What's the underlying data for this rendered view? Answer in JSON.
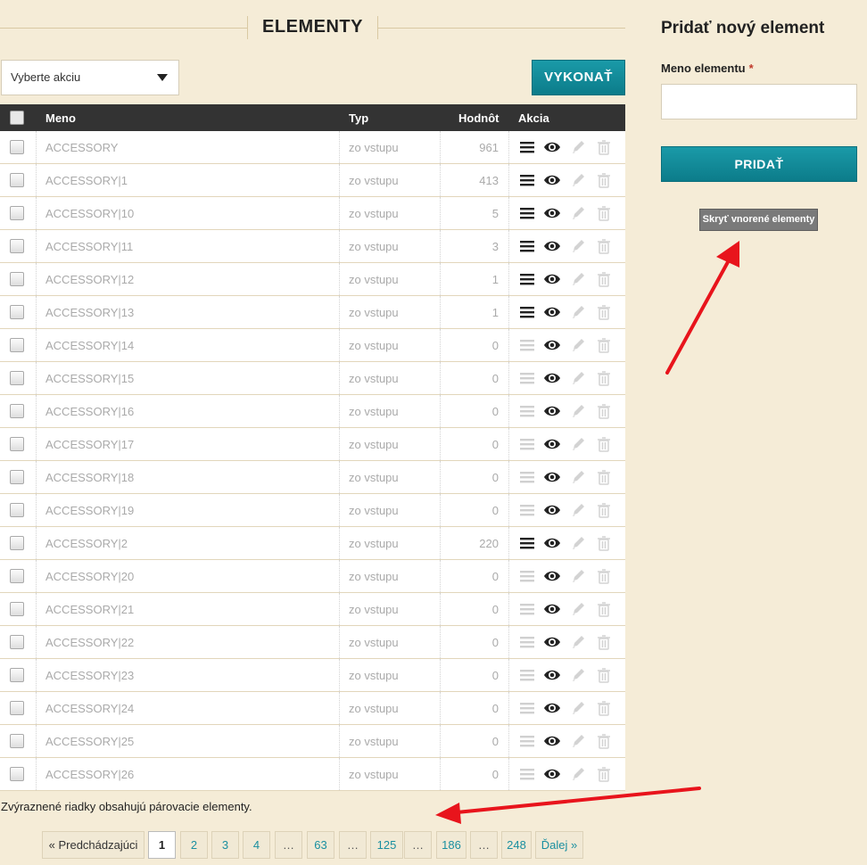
{
  "header": {
    "title": "ELEMENTY"
  },
  "bulk": {
    "select_label": "Vyberte akciu",
    "execute_label": "VYKONAŤ"
  },
  "table": {
    "columns": {
      "name": "Meno",
      "type": "Typ",
      "value": "Hodnôt",
      "actions": "Akcia"
    },
    "rows": [
      {
        "name": "ACCESSORY",
        "type": "zo vstupu",
        "value": "961",
        "active": true
      },
      {
        "name": "ACCESSORY|1",
        "type": "zo vstupu",
        "value": "413",
        "active": true
      },
      {
        "name": "ACCESSORY|10",
        "type": "zo vstupu",
        "value": "5",
        "active": true
      },
      {
        "name": "ACCESSORY|11",
        "type": "zo vstupu",
        "value": "3",
        "active": true
      },
      {
        "name": "ACCESSORY|12",
        "type": "zo vstupu",
        "value": "1",
        "active": true
      },
      {
        "name": "ACCESSORY|13",
        "type": "zo vstupu",
        "value": "1",
        "active": true
      },
      {
        "name": "ACCESSORY|14",
        "type": "zo vstupu",
        "value": "0",
        "active": false
      },
      {
        "name": "ACCESSORY|15",
        "type": "zo vstupu",
        "value": "0",
        "active": false
      },
      {
        "name": "ACCESSORY|16",
        "type": "zo vstupu",
        "value": "0",
        "active": false
      },
      {
        "name": "ACCESSORY|17",
        "type": "zo vstupu",
        "value": "0",
        "active": false
      },
      {
        "name": "ACCESSORY|18",
        "type": "zo vstupu",
        "value": "0",
        "active": false
      },
      {
        "name": "ACCESSORY|19",
        "type": "zo vstupu",
        "value": "0",
        "active": false
      },
      {
        "name": "ACCESSORY|2",
        "type": "zo vstupu",
        "value": "220",
        "active": true
      },
      {
        "name": "ACCESSORY|20",
        "type": "zo vstupu",
        "value": "0",
        "active": false
      },
      {
        "name": "ACCESSORY|21",
        "type": "zo vstupu",
        "value": "0",
        "active": false
      },
      {
        "name": "ACCESSORY|22",
        "type": "zo vstupu",
        "value": "0",
        "active": false
      },
      {
        "name": "ACCESSORY|23",
        "type": "zo vstupu",
        "value": "0",
        "active": false
      },
      {
        "name": "ACCESSORY|24",
        "type": "zo vstupu",
        "value": "0",
        "active": false
      },
      {
        "name": "ACCESSORY|25",
        "type": "zo vstupu",
        "value": "0",
        "active": false
      },
      {
        "name": "ACCESSORY|26",
        "type": "zo vstupu",
        "value": "0",
        "active": false
      }
    ]
  },
  "note": "Zvýraznené riadky obsahujú párovacie elementy.",
  "pagination": {
    "prev": "« Predchádzajúci",
    "next": "Ďalej »",
    "items": [
      "1",
      "2",
      "3",
      "4",
      "…",
      "63",
      "…",
      "125",
      "…",
      "186",
      "…",
      "248"
    ],
    "current": "1"
  },
  "sidebar": {
    "title": "Pridať nový element",
    "name_label": "Meno elementu",
    "required_mark": "*",
    "name_value": "",
    "add_label": "PRIDAŤ",
    "hide_nested_label": "Skryť vnorené elementy"
  },
  "colors": {
    "accent": "#0c7c8a",
    "annotation_arrow": "#e8141c",
    "background": "#f5ecd7"
  },
  "icons": {
    "row_actions": [
      "list-icon",
      "eye-icon",
      "pencil-icon",
      "trash-icon"
    ]
  }
}
